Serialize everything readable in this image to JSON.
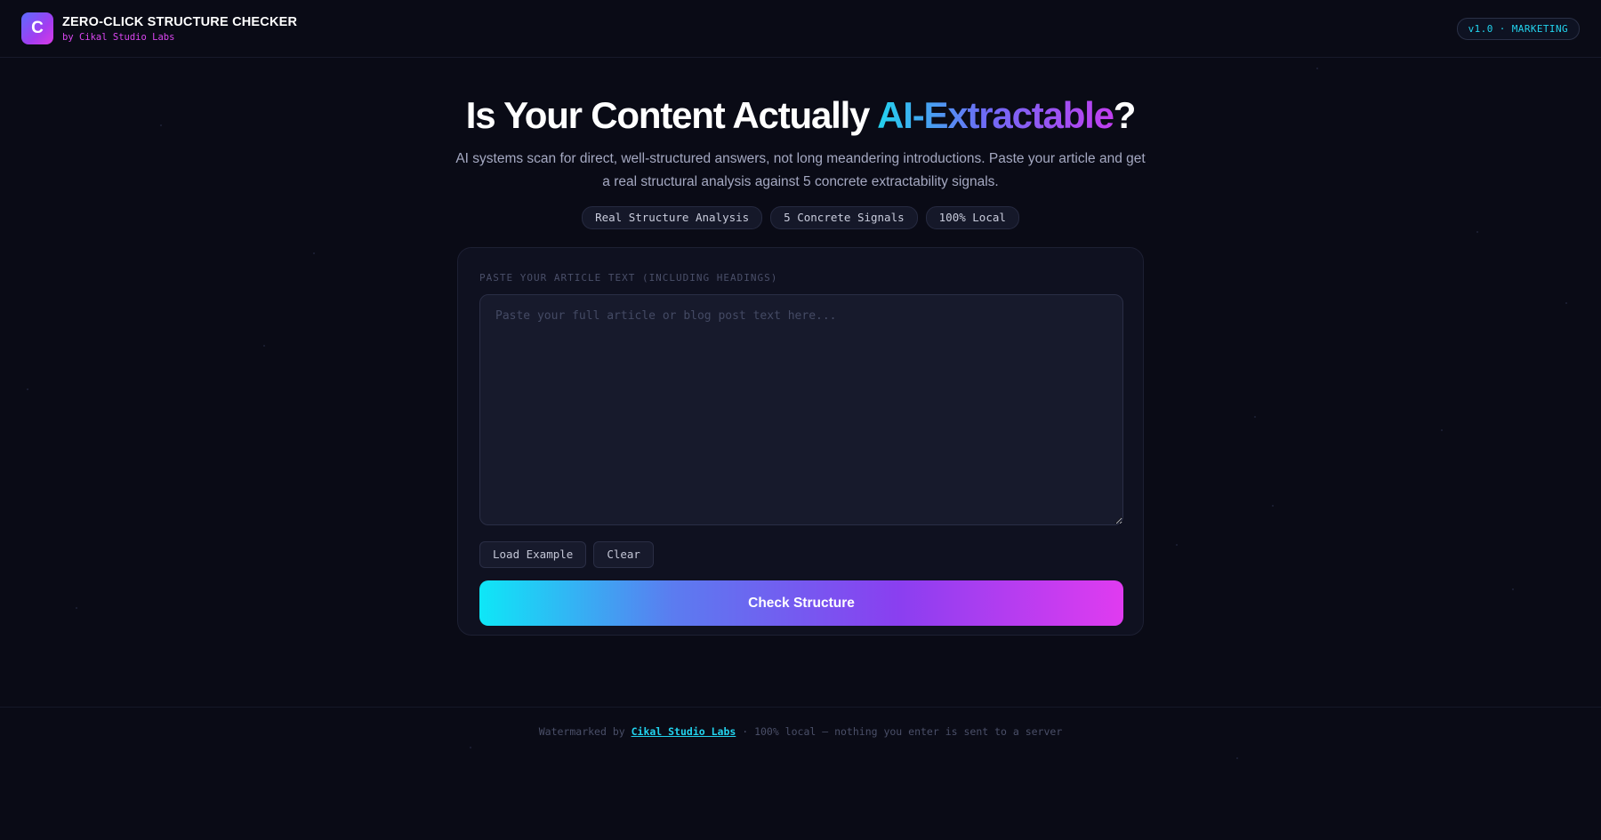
{
  "header": {
    "logo_letter": "C",
    "title": "ZERO-CLICK STRUCTURE CHECKER",
    "subtitle": "by Cikal Studio Labs",
    "version_badge": "v1.0 · MARKETING"
  },
  "hero": {
    "title_before": "Is Your Content Actually ",
    "title_highlight": "AI-Extractable",
    "title_after": "?",
    "description": "AI systems scan for direct, well-structured answers, not long meandering introductions. Paste your article and get a real structural analysis against 5 concrete extractability signals.",
    "pills": [
      "Real Structure Analysis",
      "5 Concrete Signals",
      "100% Local"
    ]
  },
  "form": {
    "label": "PASTE YOUR ARTICLE TEXT (INCLUDING HEADINGS)",
    "placeholder": "Paste your full article or blog post text here...",
    "value": "",
    "load_example_label": "Load Example",
    "clear_label": "Clear",
    "submit_label": "Check Structure"
  },
  "footer": {
    "prefix": "Watermarked by ",
    "link_text": "Cikal Studio Labs",
    "suffix": " · 100% local — nothing you enter is sent to a server"
  },
  "colors": {
    "background": "#0a0b16",
    "accent_cyan": "#22d3ee",
    "accent_magenta": "#d946ef",
    "accent_purple": "#8a3ff0"
  }
}
